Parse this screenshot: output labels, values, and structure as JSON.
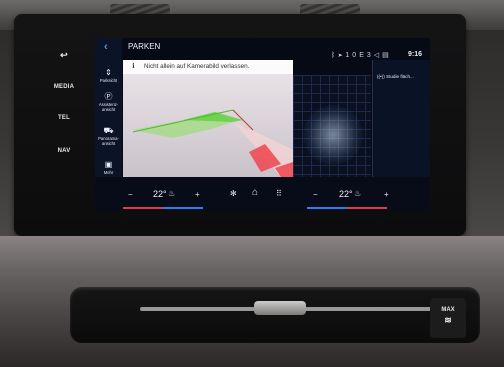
{
  "left_buttons": [
    {
      "label": "↩",
      "icon": "back-arrow-icon"
    },
    {
      "label": "MEDIA"
    },
    {
      "label": "TEL"
    },
    {
      "label": "NAV"
    }
  ],
  "screen": {
    "title": "PARKEN",
    "status_bar": {
      "time": "9:16",
      "icons": [
        "bluetooth-icon",
        "navigation-icon",
        "signal-icon",
        "volume-icon",
        "card-icon"
      ],
      "network_label": "10E3"
    },
    "notice": {
      "icon": "i",
      "text": "Nicht allein auf Kamerabild verlassen."
    },
    "rail_items": [
      {
        "label": "Parksicht",
        "icon": "parking-view-icon"
      },
      {
        "label": "Assistenz-ansicht",
        "icon": "p-icon"
      },
      {
        "label": "Panorama-ansicht",
        "icon": "panorama-car-icon"
      },
      {
        "label": "Mehr",
        "icon": "more-icon"
      }
    ],
    "side_panel": {
      "label": "Studie fläch...",
      "icon": "audio-icon"
    }
  },
  "climate_bar": {
    "left_temp": "22°",
    "right_temp": "22°",
    "left_minus": "−",
    "left_plus": "+",
    "right_minus": "−",
    "right_plus": "+"
  },
  "console": {
    "max_label": "MAX"
  },
  "colors": {
    "accent_blue": "#2d7ff0",
    "accent_red": "#e03a4a",
    "camera_green": "#77d65a",
    "camera_red": "#ef4b55"
  }
}
